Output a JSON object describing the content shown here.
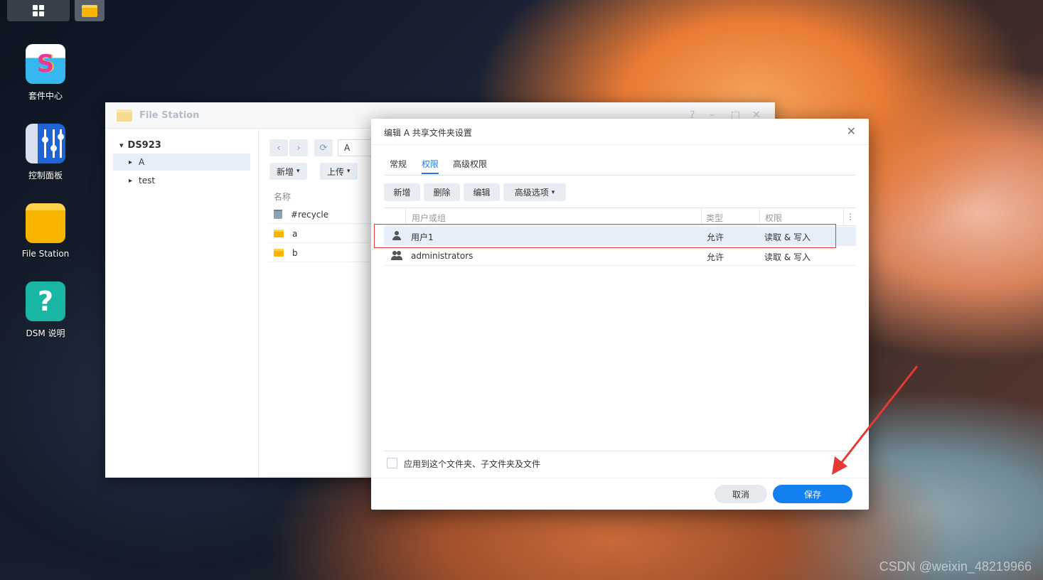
{
  "desktop": {
    "icons": [
      {
        "label": "套件中心"
      },
      {
        "label": "控制面板"
      },
      {
        "label": "File Station"
      },
      {
        "label": "DSM 说明"
      }
    ]
  },
  "file_station": {
    "title": "File Station",
    "tree_root": "DS923",
    "tree_items": [
      "A",
      "test"
    ],
    "path_value": "A",
    "toolbar": {
      "new_label": "新增",
      "upload_label": "上传"
    },
    "column_name": "名称",
    "files": [
      "#recycle",
      "a",
      "b"
    ]
  },
  "dialog": {
    "title": "编辑 A 共享文件夹设置",
    "tabs": [
      "常规",
      "权限",
      "高级权限"
    ],
    "active_tab": "权限",
    "buttons": {
      "add": "新增",
      "delete": "删除",
      "edit": "编辑",
      "advanced": "高级选项"
    },
    "columns": [
      "用户或组",
      "类型",
      "权限"
    ],
    "rows": [
      {
        "name": "用户1",
        "type": "允许",
        "perm": "读取 & 写入",
        "icon": "user-icon"
      },
      {
        "name": "administrators",
        "type": "允许",
        "perm": "读取 & 写入",
        "icon": "group-icon"
      }
    ],
    "apply_label": "应用到这个文件夹、子文件夹及文件",
    "cancel_label": "取消",
    "save_label": "保存"
  },
  "watermark": "CSDN @weixin_48219966",
  "colors": {
    "accent": "#1480f0",
    "highlight": "#e53935"
  }
}
